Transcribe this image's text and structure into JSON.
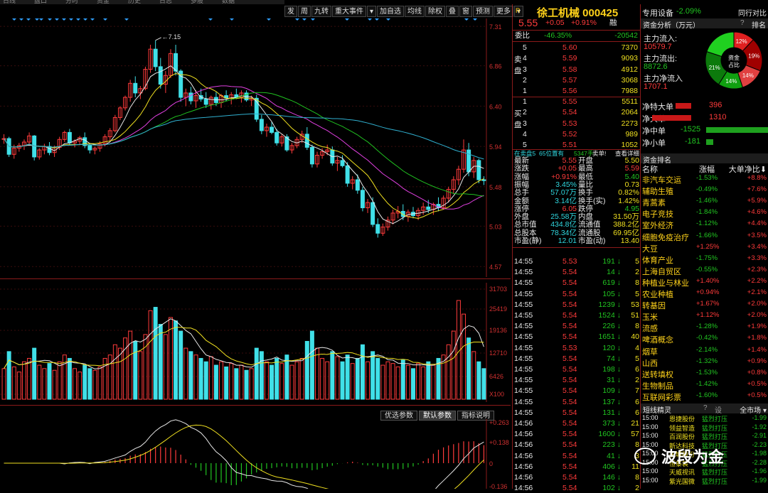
{
  "top_strip": [
    "日线",
    "盘口",
    "分时",
    "资金",
    "历史",
    "日志",
    "多股",
    "数据"
  ],
  "toolbar": [
    "发",
    "周",
    "九转",
    "重大事件",
    "▾",
    "加自选",
    "均线",
    "除权",
    "叠",
    "窗",
    "预测",
    "更多",
    "▾"
  ],
  "price_axis": [
    "7.31",
    "6.86",
    "6.40",
    "5.94",
    "5.48",
    "5.03",
    "4.57"
  ],
  "high_label": "7.15",
  "vol_axis": [
    "31703",
    "25419",
    "19136",
    "12710",
    "6426",
    "X100"
  ],
  "ind_axis": [
    "+0.263",
    "+0.138",
    "0",
    "-0.136"
  ],
  "ind_tabs": [
    "优选参数",
    "默认参数",
    "指标说明"
  ],
  "chart_data": {
    "type": "candlestick",
    "candles": [
      [
        6.02,
        6.08,
        5.97,
        6.03
      ],
      [
        6.03,
        6.05,
        5.82,
        5.85
      ],
      [
        5.85,
        5.96,
        5.8,
        5.92
      ],
      [
        5.92,
        5.98,
        5.88,
        5.95
      ],
      [
        5.95,
        6.02,
        5.9,
        5.99
      ],
      [
        5.99,
        6.1,
        5.96,
        6.06
      ],
      [
        6.06,
        6.07,
        5.78,
        5.82
      ],
      [
        5.82,
        5.92,
        5.79,
        5.9
      ],
      [
        5.9,
        5.97,
        5.85,
        5.94
      ],
      [
        5.94,
        5.99,
        5.84,
        5.87
      ],
      [
        5.87,
        5.95,
        5.82,
        5.93
      ],
      [
        5.93,
        6.05,
        5.9,
        6.02
      ],
      [
        6.02,
        6.12,
        5.99,
        6.1
      ],
      [
        6.1,
        6.14,
        5.95,
        5.98
      ],
      [
        5.98,
        6.02,
        5.93,
        6.0
      ],
      [
        6.0,
        6.06,
        5.96,
        6.04
      ],
      [
        6.04,
        6.1,
        5.92,
        5.95
      ],
      [
        5.95,
        5.98,
        5.86,
        5.9
      ],
      [
        5.9,
        5.94,
        5.85,
        5.92
      ],
      [
        5.92,
        6.0,
        5.88,
        5.97
      ],
      [
        5.97,
        6.08,
        5.94,
        6.05
      ],
      [
        6.05,
        6.15,
        6.0,
        6.12
      ],
      [
        6.12,
        6.3,
        6.1,
        6.27
      ],
      [
        6.27,
        6.4,
        6.24,
        6.38
      ],
      [
        6.38,
        6.52,
        6.35,
        6.5
      ],
      [
        6.5,
        6.7,
        6.45,
        6.66
      ],
      [
        6.66,
        6.74,
        6.5,
        6.55
      ],
      [
        6.55,
        6.63,
        6.48,
        6.6
      ],
      [
        6.6,
        6.85,
        6.58,
        6.82
      ],
      [
        6.82,
        7.1,
        6.78,
        7.05
      ],
      [
        7.05,
        7.15,
        6.8,
        6.85
      ],
      [
        6.85,
        6.95,
        6.6,
        6.65
      ],
      [
        6.65,
        6.8,
        6.55,
        6.75
      ],
      [
        6.75,
        7.05,
        6.72,
        7.0
      ],
      [
        7.0,
        7.1,
        6.75,
        6.8
      ],
      [
        6.8,
        6.82,
        6.45,
        6.5
      ],
      [
        6.5,
        6.6,
        6.4,
        6.55
      ],
      [
        6.55,
        6.62,
        6.42,
        6.46
      ],
      [
        6.46,
        6.58,
        6.38,
        6.52
      ],
      [
        6.52,
        6.6,
        6.45,
        6.48
      ],
      [
        6.48,
        6.56,
        6.38,
        6.42
      ],
      [
        6.42,
        6.52,
        6.36,
        6.5
      ],
      [
        6.5,
        6.56,
        6.4,
        6.44
      ],
      [
        6.44,
        6.54,
        6.38,
        6.52
      ],
      [
        6.52,
        6.58,
        6.46,
        6.49
      ],
      [
        6.49,
        6.56,
        6.42,
        6.53
      ],
      [
        6.53,
        6.6,
        6.48,
        6.5
      ],
      [
        6.5,
        6.58,
        6.44,
        6.55
      ],
      [
        6.55,
        6.58,
        6.45,
        6.47
      ],
      [
        6.47,
        6.52,
        6.4,
        6.49
      ],
      [
        6.49,
        6.53,
        6.22,
        6.25
      ],
      [
        6.25,
        6.3,
        6.08,
        6.12
      ],
      [
        6.12,
        6.2,
        6.05,
        6.16
      ],
      [
        6.16,
        6.22,
        6.08,
        6.1
      ],
      [
        6.1,
        6.14,
        5.95,
        5.98
      ],
      [
        5.98,
        6.08,
        5.94,
        6.05
      ],
      [
        6.05,
        6.08,
        5.88,
        5.9
      ],
      [
        5.9,
        5.98,
        5.86,
        5.95
      ],
      [
        5.95,
        6.05,
        5.92,
        6.02
      ],
      [
        6.02,
        6.12,
        5.98,
        6.08
      ],
      [
        6.08,
        6.16,
        5.9,
        5.93
      ],
      [
        5.93,
        5.96,
        5.7,
        5.74
      ],
      [
        5.74,
        5.88,
        5.7,
        5.84
      ],
      [
        5.84,
        5.92,
        5.8,
        5.88
      ],
      [
        5.88,
        5.96,
        5.84,
        5.9
      ],
      [
        5.9,
        5.94,
        5.72,
        5.75
      ],
      [
        5.75,
        5.82,
        5.66,
        5.78
      ],
      [
        5.78,
        5.84,
        5.7,
        5.72
      ],
      [
        5.72,
        5.76,
        5.48,
        5.52
      ],
      [
        5.52,
        5.6,
        5.45,
        5.56
      ],
      [
        5.56,
        5.62,
        5.4,
        5.44
      ],
      [
        5.44,
        5.48,
        5.2,
        5.24
      ],
      [
        5.24,
        5.34,
        5.18,
        5.3
      ],
      [
        5.3,
        5.36,
        5.02,
        5.05
      ],
      [
        5.05,
        5.12,
        4.9,
        4.95
      ],
      [
        4.95,
        5.06,
        4.92,
        5.02
      ],
      [
        5.02,
        5.14,
        4.98,
        5.1
      ],
      [
        5.1,
        5.22,
        5.05,
        5.18
      ],
      [
        5.18,
        5.26,
        5.12,
        5.2
      ],
      [
        5.2,
        5.28,
        5.1,
        5.14
      ],
      [
        5.14,
        5.22,
        5.08,
        5.19
      ],
      [
        5.19,
        5.25,
        5.12,
        5.15
      ],
      [
        5.15,
        5.24,
        5.1,
        5.21
      ],
      [
        5.21,
        5.3,
        5.16,
        5.25
      ],
      [
        5.25,
        5.33,
        5.18,
        5.22
      ],
      [
        5.22,
        5.3,
        5.16,
        5.28
      ],
      [
        5.28,
        5.36,
        5.2,
        5.24
      ],
      [
        5.24,
        5.38,
        5.22,
        5.35
      ],
      [
        5.35,
        5.48,
        5.3,
        5.45
      ],
      [
        5.45,
        5.6,
        5.4,
        5.56
      ],
      [
        5.56,
        5.72,
        5.5,
        5.68
      ],
      [
        5.68,
        6.02,
        5.64,
        5.9
      ],
      [
        5.9,
        5.98,
        5.6,
        5.65
      ],
      [
        5.65,
        5.82,
        5.58,
        5.78
      ],
      [
        5.78,
        5.8,
        5.52,
        5.56
      ],
      [
        5.56,
        5.6,
        5.5,
        5.55
      ]
    ],
    "volumes": [
      9000,
      14000,
      9500,
      8000,
      11000,
      12000,
      15000,
      10000,
      9000,
      10500,
      8500,
      11000,
      13000,
      12000,
      9000,
      8000,
      10000,
      9000,
      8500,
      9500,
      12000,
      13000,
      16000,
      15000,
      18000,
      20000,
      17000,
      14000,
      19000,
      26000,
      27000,
      22000,
      19000,
      24000,
      23000,
      20000,
      15000,
      14000,
      13000,
      12000,
      11000,
      12500,
      10000,
      11000,
      9500,
      10500,
      9000,
      10000,
      8500,
      9000,
      15000,
      14000,
      11000,
      10000,
      12000,
      10500,
      13000,
      10000,
      11000,
      12000,
      17000,
      20000,
      15000,
      12000,
      11000,
      14000,
      12500,
      11000,
      13000,
      10500,
      12000,
      16000,
      11000,
      14000,
      12000,
      10000,
      11000,
      10500,
      9500,
      11500,
      10000,
      9000,
      10500,
      9500,
      11000,
      10000,
      12000,
      13000,
      16000,
      20000,
      29000,
      25000,
      18000,
      14000,
      11000,
      9000
    ],
    "ylim": [
      4.57,
      7.31
    ],
    "vol_max": 31703
  },
  "quote": {
    "flag": "R",
    "title": "徐工机械 000425",
    "price": "5.55",
    "change": "+0.05",
    "change_pct": "+0.91%",
    "tag": "融",
    "weibi_label": "委比",
    "weibi_pct": "-46.35%",
    "weibi_diff": "-20542",
    "sell_label": "卖盘",
    "buy_label": "买盘",
    "asks": [
      [
        "5",
        "5.60",
        "7370"
      ],
      [
        "4",
        "5.59",
        "9093"
      ],
      [
        "3",
        "5.58",
        "4912"
      ],
      [
        "2",
        "5.57",
        "3068"
      ],
      [
        "1",
        "5.56",
        "7988"
      ]
    ],
    "bids": [
      [
        "1",
        "5.55",
        "5511"
      ],
      [
        "2",
        "5.54",
        "2064"
      ],
      [
        "3",
        "5.53",
        "2273"
      ],
      [
        "4",
        "5.52",
        "989"
      ],
      [
        "5",
        "5.51",
        "1052"
      ]
    ],
    "queue_label": "在卖盘5",
    "queue_pos": "65位置有",
    "queue_qty": "5347手",
    "queue_sell": "卖单!",
    "queue_detail": "查看详细",
    "stats": [
      [
        "最新",
        "5.55",
        "开盘",
        "5.50"
      ],
      [
        "涨跌",
        "+0.05",
        "最高",
        "5.59"
      ],
      [
        "涨幅",
        "+0.91%",
        "最低",
        "5.40"
      ],
      [
        "振幅",
        "3.45%",
        "量比",
        "0.73"
      ],
      [
        "总手",
        "57.07万",
        "换手",
        "0.82%"
      ],
      [
        "金额",
        "3.14亿",
        "换手(实)",
        "1.42%"
      ],
      [
        "涨停",
        "6.05",
        "跌停",
        "4.95"
      ],
      [
        "外盘",
        "25.58万",
        "内盘",
        "31.50万"
      ],
      [
        "总市值",
        "434.8亿",
        "流通值",
        "388.2亿"
      ],
      [
        "总股本",
        "78.34亿",
        "流通股",
        "69.95亿"
      ],
      [
        "市盈(静)",
        "12.01",
        "市盈(动)",
        "13.40"
      ]
    ],
    "ticks": [
      [
        "14:55",
        "5.53",
        "191",
        "down",
        "5"
      ],
      [
        "14:55",
        "5.54",
        "14",
        "down",
        "2"
      ],
      [
        "14:55",
        "5.54",
        "619",
        "down",
        "8"
      ],
      [
        "14:55",
        "5.54",
        "105",
        "down",
        "5"
      ],
      [
        "14:55",
        "5.54",
        "1239",
        "down",
        "53"
      ],
      [
        "14:55",
        "5.54",
        "1524",
        "down",
        "51"
      ],
      [
        "14:55",
        "5.54",
        "226",
        "down",
        "8"
      ],
      [
        "14:55",
        "5.54",
        "1651",
        "down",
        "40"
      ],
      [
        "14:55",
        "5.53",
        "120",
        "down",
        "4"
      ],
      [
        "14:55",
        "5.54",
        "74",
        "down",
        "5"
      ],
      [
        "14:55",
        "5.54",
        "198",
        "down",
        "6"
      ],
      [
        "14:55",
        "5.54",
        "31",
        "down",
        "2"
      ],
      [
        "14:55",
        "5.54",
        "109",
        "down",
        "7"
      ],
      [
        "14:55",
        "5.54",
        "137",
        "down",
        "6"
      ],
      [
        "14:55",
        "5.54",
        "131",
        "down",
        "6"
      ],
      [
        "14:56",
        "5.54",
        "373",
        "down",
        "21"
      ],
      [
        "14:56",
        "5.54",
        "1600",
        "down",
        "57"
      ],
      [
        "14:56",
        "5.54",
        "223",
        "down",
        "8"
      ],
      [
        "14:56",
        "5.54",
        "41",
        "down",
        "3"
      ],
      [
        "14:56",
        "5.54",
        "406",
        "down",
        "11"
      ],
      [
        "14:56",
        "5.54",
        "146",
        "down",
        "8"
      ],
      [
        "14:56",
        "5.54",
        "102",
        "down",
        "2"
      ]
    ]
  },
  "rp": {
    "header_label": "专用设备",
    "header_change": "-2.09%",
    "header_btn": "同行对比",
    "fund_title": "资金分析（万元）",
    "fund_help": "?",
    "fund_rank": "排名",
    "inflow_label": "主力流入:",
    "inflow_val": "10579.7",
    "outflow_label": "主力流出:",
    "outflow_val": "8872.6",
    "net_label": "主力净流入",
    "net_val": "1707.1",
    "donut_center1": "资金",
    "donut_center2": "占比",
    "donut": [
      {
        "label": "12%",
        "color": "#e02020",
        "val": 12
      },
      {
        "label": "19%",
        "color": "#a00000",
        "val": 19
      },
      {
        "label": "14%",
        "color": "#e04040",
        "val": 14
      },
      {
        "label": "14%",
        "color": "#10a010",
        "val": 14
      },
      {
        "label": "21%",
        "color": "#0c7a0c",
        "val": 21
      },
      {
        "label": "",
        "color": "#20d020",
        "val": 20
      }
    ],
    "flows": [
      {
        "label": "净特大单",
        "val": "396",
        "dir": "pos",
        "num": 396
      },
      {
        "label": "净大单",
        "val": "1310",
        "dir": "pos",
        "num": 1310
      },
      {
        "label": "净中单",
        "val": "-1525",
        "dir": "neg",
        "num": 1525
      },
      {
        "label": "净小单",
        "val": "-181",
        "dir": "neg",
        "num": 181
      }
    ],
    "rank_title": "资金排名",
    "rank_cols": [
      "名称",
      "涨幅",
      "大单净比"
    ],
    "rank": [
      [
        "非汽车交运",
        "-1.53%",
        "+8.8%"
      ],
      [
        "辅助生殖",
        "-0.49%",
        "+7.6%"
      ],
      [
        "青蒿素",
        "-1.46%",
        "+5.9%"
      ],
      [
        "电子竞技",
        "-1.84%",
        "+4.6%"
      ],
      [
        "室外经济",
        "-1.12%",
        "+4.4%"
      ],
      [
        "细胞免疫治疗",
        "-1.66%",
        "+3.5%"
      ],
      [
        "大豆",
        "+1.25%",
        "+3.4%"
      ],
      [
        "体育产业",
        "-1.75%",
        "+3.3%"
      ],
      [
        "上海自贸区",
        "-0.55%",
        "+2.3%"
      ],
      [
        "种植业与林业",
        "+1.40%",
        "+2.2%"
      ],
      [
        "农业种植",
        "+0.94%",
        "+2.1%"
      ],
      [
        "转基因",
        "+1.67%",
        "+2.0%"
      ],
      [
        "玉米",
        "+1.12%",
        "+2.0%"
      ],
      [
        "流感",
        "-1.28%",
        "+1.9%"
      ],
      [
        "啤酒概念",
        "-0.42%",
        "+1.8%"
      ],
      [
        "烟草",
        "-2.14%",
        "+1.4%"
      ],
      [
        "山西",
        "-1.32%",
        "+0.9%"
      ],
      [
        "送转填权",
        "-1.53%",
        "+0.8%"
      ],
      [
        "生物制品",
        "-1.42%",
        "+0.5%"
      ],
      [
        "互联网彩票",
        "-1.60%",
        "+0.5%"
      ]
    ],
    "elf_title": "短线精灵",
    "elf_btn1": "?",
    "elf_btn2": "设",
    "elf_market": "全市场",
    "elf": [
      [
        "15:00",
        "恩捷股份",
        "猛烈打压",
        "-1.99"
      ],
      [
        "15:00",
        "领益智造",
        "猛烈打压",
        "-1.92"
      ],
      [
        "15:00",
        "百润股份",
        "猛烈打压",
        "-2.91"
      ],
      [
        "15:00",
        "新达科技",
        "猛烈打压",
        "-2.23"
      ],
      [
        "15:00",
        "长城股份",
        "猛烈打压",
        "-1.98"
      ],
      [
        "15:00",
        "恒泰装",
        "猛烈打压",
        "-2.28"
      ],
      [
        "15:00",
        "天威视讯",
        "猛烈打压",
        "-1.96"
      ],
      [
        "15:00",
        "紫光国微",
        "猛烈打压",
        "-1.99"
      ]
    ],
    "watermark": "波段为金"
  }
}
